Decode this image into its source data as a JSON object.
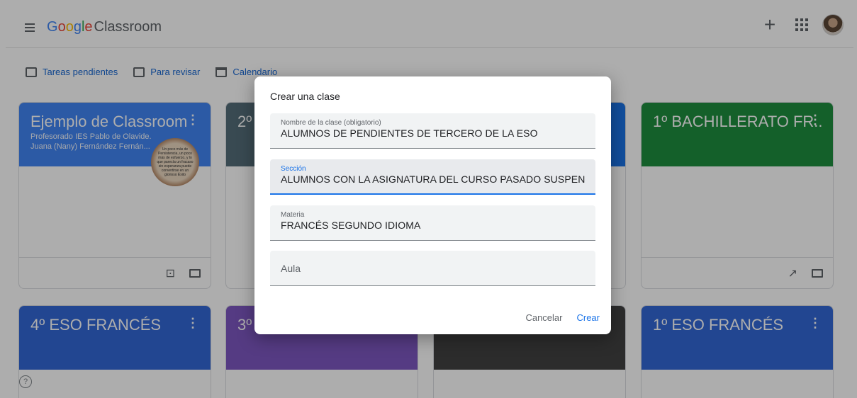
{
  "header": {
    "logo_google": [
      "G",
      "o",
      "o",
      "g",
      "l",
      "e"
    ],
    "logo_colors": [
      "#4285f4",
      "#ea4335",
      "#fbbc05",
      "#4285f4",
      "#34a853",
      "#ea4335"
    ],
    "product": "Classroom",
    "plus": "+"
  },
  "toolbar": {
    "pending": "Tareas pendientes",
    "review": "Para revisar",
    "calendar": "Calendario"
  },
  "cards": [
    {
      "title": "Ejemplo de Classroom",
      "sub1": "Profesorado IES Pablo de Olavide.",
      "sub2": "Juana (Nany) Fernández Fernán...",
      "color": "#4285f4"
    },
    {
      "title": "2º",
      "color": "#546e7a"
    },
    {
      "title": "",
      "color": "#1a73e8"
    },
    {
      "title": "1º BACHILLERATO FR...",
      "color": "#1e8e3e"
    },
    {
      "title": "4º ESO FRANCÉS",
      "color": "#3367d6"
    },
    {
      "title": "3º",
      "color": "#7e57c2"
    },
    {
      "title": "",
      "color": "#424242"
    },
    {
      "title": "1º ESO FRANCÉS",
      "color": "#3367d6"
    }
  ],
  "badge_text": "Un poco más de Persistencia, un poco más de esfuerzo, y lo que parecía un fracaso sin esperanza puede convertirse en un glorioso Éxito",
  "dialog": {
    "title": "Crear una clase",
    "fields": [
      {
        "label": "Nombre de la clase (obligatorio)",
        "value": "ALUMNOS DE PENDIENTES DE TERCERO DE LA ESO"
      },
      {
        "label": "Sección",
        "value": "ALUMNOS CON LA ASIGNATURA DEL CURSO PASADO SUSPENSA"
      },
      {
        "label": "Materia",
        "value": "FRANCÉS SEGUNDO IDIOMA"
      },
      {
        "label": "",
        "placeholder": "Aula"
      }
    ],
    "cancel": "Cancelar",
    "create": "Crear"
  },
  "help": "?"
}
